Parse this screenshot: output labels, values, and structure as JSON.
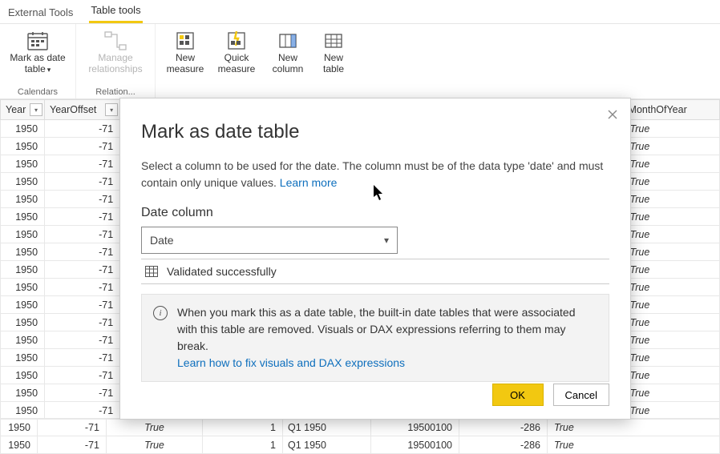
{
  "tabs": {
    "external": "External Tools",
    "table_tools": "Table tools"
  },
  "ribbon": {
    "mark_date_l1": "Mark as date",
    "mark_date_l2": "table",
    "manage_rel_l1": "Manage",
    "manage_rel_l2": "relationships",
    "new_measure_l1": "New",
    "new_measure_l2": "measure",
    "quick_measure_l1": "Quick",
    "quick_measure_l2": "measure",
    "new_column_l1": "New",
    "new_column_l2": "column",
    "new_table_l1": "New",
    "new_table_l2": "table",
    "group_calendars": "Calendars",
    "group_relations": "Relation..."
  },
  "columns": {
    "year": "Year",
    "year_offset": "YearOffset",
    "ym": "Y",
    "month_of_year": "MonthOfYear"
  },
  "rows": [
    {
      "year": "1950",
      "yo": "-71",
      "moy": "True"
    },
    {
      "year": "1950",
      "yo": "-71",
      "moy": "True"
    },
    {
      "year": "1950",
      "yo": "-71",
      "moy": "True"
    },
    {
      "year": "1950",
      "yo": "-71",
      "moy": "True"
    },
    {
      "year": "1950",
      "yo": "-71",
      "moy": "True"
    },
    {
      "year": "1950",
      "yo": "-71",
      "moy": "True"
    },
    {
      "year": "1950",
      "yo": "-71",
      "moy": "True"
    },
    {
      "year": "1950",
      "yo": "-71",
      "moy": "True"
    },
    {
      "year": "1950",
      "yo": "-71",
      "moy": "True"
    },
    {
      "year": "1950",
      "yo": "-71",
      "moy": "True"
    },
    {
      "year": "1950",
      "yo": "-71",
      "moy": "True"
    },
    {
      "year": "1950",
      "yo": "-71",
      "moy": "True"
    },
    {
      "year": "1950",
      "yo": "-71",
      "moy": "True"
    },
    {
      "year": "1950",
      "yo": "-71",
      "moy": "True"
    },
    {
      "year": "1950",
      "yo": "-71",
      "moy": "True"
    },
    {
      "year": "1950",
      "yo": "-71",
      "moy": "True"
    },
    {
      "year": "1950",
      "yo": "-71",
      "moy": "True"
    }
  ],
  "under_rows": [
    {
      "c1": "True",
      "c2": "1",
      "c3": "Q1 1950",
      "c4": "19500100",
      "c5": "-286"
    },
    {
      "c1": "True",
      "c2": "1",
      "c3": "Q1 1950",
      "c4": "19500100",
      "c5": "-286"
    }
  ],
  "dialog": {
    "title": "Mark as date table",
    "desc": "Select a column to be used for the date. The column must be of the data type 'date' and must contain only unique values. ",
    "learn_more": "Learn more",
    "label": "Date column",
    "selected": "Date",
    "validated": "Validated successfully",
    "warn": "When you mark this as a date table, the built-in date tables that were associated with this table are removed. Visuals or DAX expressions referring to them may break.",
    "warn_link": "Learn how to fix visuals and DAX expressions",
    "ok": "OK",
    "cancel": "Cancel"
  }
}
